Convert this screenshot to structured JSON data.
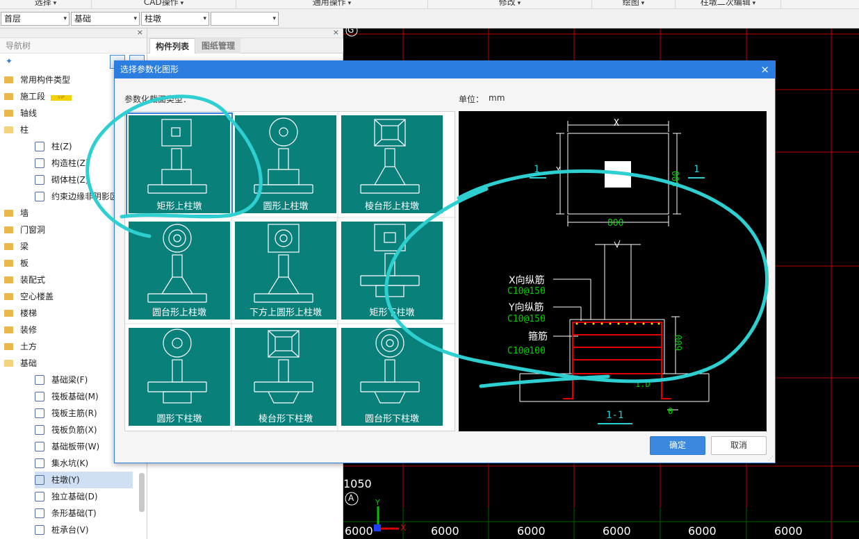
{
  "top_menu": [
    "选择",
    "CAD操作",
    "通用操作",
    "修改",
    "绘图",
    "柱墩二次编辑"
  ],
  "combos": [
    "首层",
    "基础",
    "柱墩",
    ""
  ],
  "nav": {
    "title": "导航树",
    "items": [
      {
        "label": "常用构件类型",
        "type": "folder"
      },
      {
        "label": "施工段",
        "type": "folder",
        "badge": "VIP"
      },
      {
        "label": "轴线",
        "type": "folder"
      },
      {
        "label": "柱",
        "type": "folder-open"
      },
      {
        "label": "柱(Z)",
        "type": "child"
      },
      {
        "label": "构造柱(Z)",
        "type": "child"
      },
      {
        "label": "砌体柱(Z)",
        "type": "child"
      },
      {
        "label": "约束边缘非阴影区",
        "type": "child"
      },
      {
        "label": "墙",
        "type": "folder"
      },
      {
        "label": "门窗洞",
        "type": "folder"
      },
      {
        "label": "梁",
        "type": "folder"
      },
      {
        "label": "板",
        "type": "folder"
      },
      {
        "label": "装配式",
        "type": "folder"
      },
      {
        "label": "空心楼盖",
        "type": "folder"
      },
      {
        "label": "楼梯",
        "type": "folder"
      },
      {
        "label": "装修",
        "type": "folder"
      },
      {
        "label": "土方",
        "type": "folder"
      },
      {
        "label": "基础",
        "type": "folder-open"
      },
      {
        "label": "基础梁(F)",
        "type": "child"
      },
      {
        "label": "筏板基础(M)",
        "type": "child"
      },
      {
        "label": "筏板主筋(R)",
        "type": "child"
      },
      {
        "label": "筏板负筋(X)",
        "type": "child"
      },
      {
        "label": "基础板带(W)",
        "type": "child"
      },
      {
        "label": "集水坑(K)",
        "type": "child"
      },
      {
        "label": "柱墩(Y)",
        "type": "child",
        "selected": true
      },
      {
        "label": "独立基础(D)",
        "type": "child"
      },
      {
        "label": "条形基础(T)",
        "type": "child"
      },
      {
        "label": "桩承台(V)",
        "type": "child"
      }
    ]
  },
  "comp_tabs": [
    "构件列表",
    "图纸管理"
  ],
  "modal": {
    "title": "选择参数化图形",
    "type_label": "参数化截面类型：",
    "unit_label": "单位：",
    "unit_value": "mm",
    "shapes": [
      {
        "label": "矩形上柱墩",
        "selected": true
      },
      {
        "label": "圆形上柱墩"
      },
      {
        "label": "棱台形上柱墩"
      },
      {
        "label": "圆台形上柱墩"
      },
      {
        "label": "下方上圆形上柱墩"
      },
      {
        "label": "矩形下柱墩"
      },
      {
        "label": "圆形下柱墩"
      },
      {
        "label": "棱台形下柱墩"
      },
      {
        "label": "圆台形下柱墩"
      }
    ],
    "ok": "确定",
    "cancel": "取消"
  },
  "preview": {
    "dim_x": "X",
    "dim_y": "Y",
    "dim_800_top": "800",
    "dim_800_bottom": "800",
    "dim_600": "600",
    "section_mark": "1",
    "section_title": "1-1",
    "x_bar_label": "X向纵筋",
    "x_bar_value": "C10@150",
    "y_bar_label": "Y向纵筋",
    "y_bar_value": "C10@150",
    "stirrup_label": "箍筋",
    "stirrup_value": "C10@100",
    "dim_0": "0",
    "dim_1d": "1.D"
  },
  "cad": {
    "axis_top": "G",
    "axis_bottom": "A",
    "dim_1050": "1050",
    "spacings": [
      "6000",
      "6000",
      "6000",
      "6000",
      "6000",
      "6000"
    ],
    "ucs_x": "X",
    "ucs_y": "Y"
  },
  "colors": {
    "accent": "#2b7de0",
    "shape_bg": "#0a807b",
    "cad_grid_red": "#c00000",
    "cad_grid_green": "#006400",
    "annotation": "#2ecfd0"
  }
}
